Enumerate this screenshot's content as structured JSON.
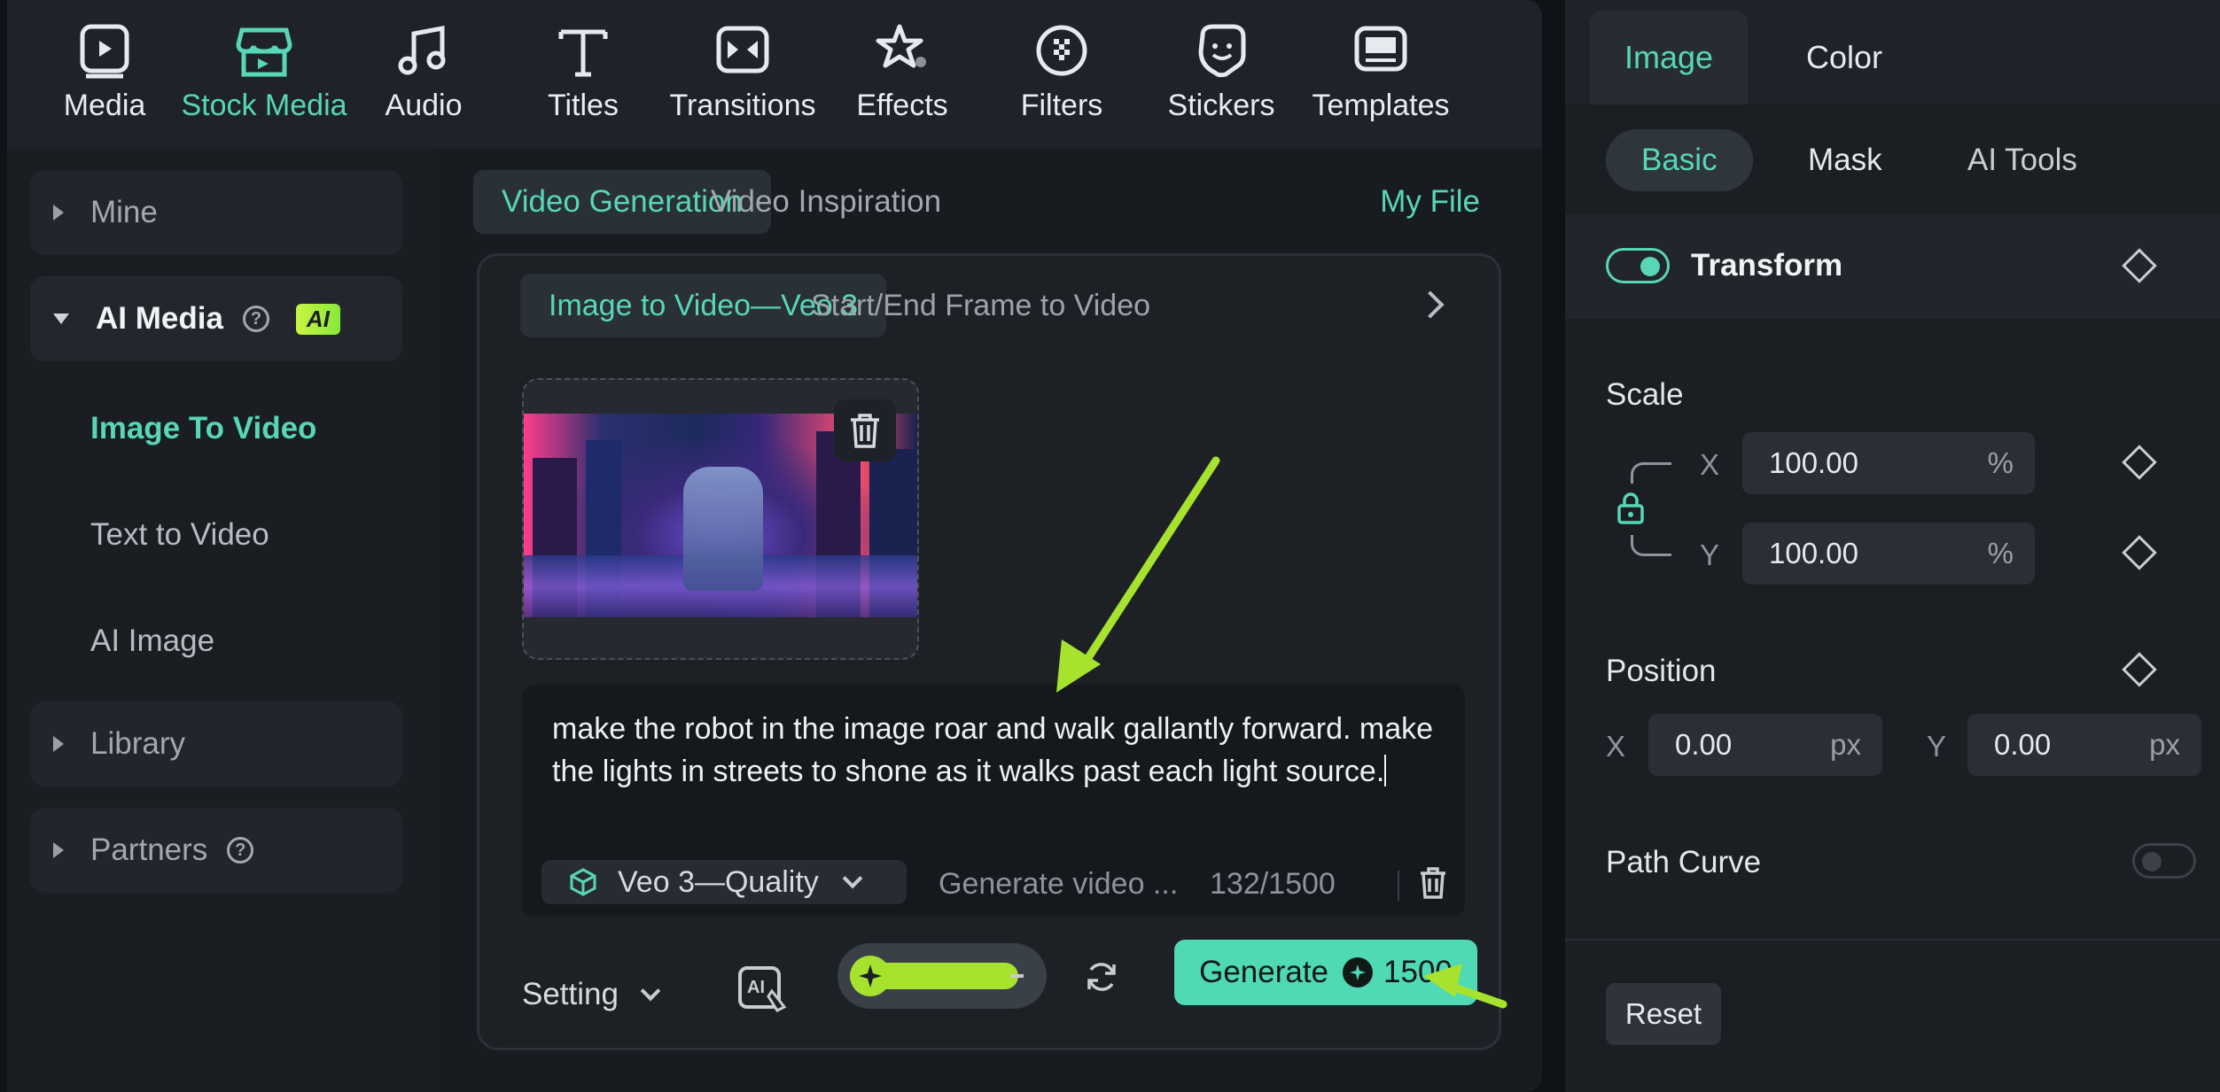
{
  "toolbar": {
    "items": [
      {
        "label": "Media",
        "icon": "media-icon"
      },
      {
        "label": "Stock Media",
        "icon": "stock-media-icon"
      },
      {
        "label": "Audio",
        "icon": "audio-icon"
      },
      {
        "label": "Titles",
        "icon": "titles-icon"
      },
      {
        "label": "Transitions",
        "icon": "transitions-icon"
      },
      {
        "label": "Effects",
        "icon": "effects-icon"
      },
      {
        "label": "Filters",
        "icon": "filters-icon"
      },
      {
        "label": "Stickers",
        "icon": "stickers-icon"
      },
      {
        "label": "Templates",
        "icon": "templates-icon"
      }
    ],
    "active": "Stock Media"
  },
  "sidebar": {
    "mine": "Mine",
    "ai_media": "AI Media",
    "ai_badge": "AI",
    "sub_items": [
      "Image To Video",
      "Text to Video",
      "AI Image"
    ],
    "library": "Library",
    "partners": "Partners"
  },
  "main": {
    "tabs": [
      "Video Generation",
      "Video Inspiration"
    ],
    "my_file": "My File",
    "subtabs": [
      "Image to Video—Veo 3",
      "Start/End Frame to Video"
    ],
    "prompt_text": "make the robot in the image roar and walk gallantly forward. make the lights in streets to shone as it walks past each light source.",
    "model": "Veo 3—Quality",
    "generate_placeholder": "Generate video ...",
    "char_count": "132/1500",
    "setting_label": "Setting",
    "generate_label": "Generate",
    "generate_cost": "1500"
  },
  "right_panel": {
    "tabs": [
      "Image",
      "Color"
    ],
    "subtabs": [
      "Basic",
      "Mask",
      "AI Tools"
    ],
    "transform_title": "Transform",
    "scale_label": "Scale",
    "scale_x_axis": "X",
    "scale_y_axis": "Y",
    "scale_x": "100.00",
    "scale_y": "100.00",
    "scale_unit": "%",
    "position_label": "Position",
    "pos_x_axis": "X",
    "pos_y_axis": "Y",
    "pos_x": "0.00",
    "pos_y": "0.00",
    "pos_unit": "px",
    "path_curve_label": "Path Curve",
    "reset_label": "Reset"
  },
  "colors": {
    "accent": "#58d6b7",
    "annotation_arrow": "#a6e22e",
    "generate_button": "#4fd9b4"
  }
}
